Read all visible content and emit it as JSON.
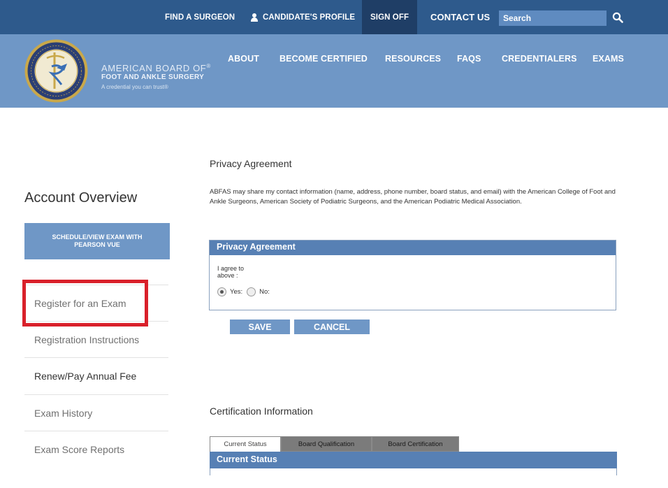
{
  "topbar": {
    "find_surgeon": "FIND A SURGEON",
    "candidate_profile": "CANDIDATE'S PROFILE",
    "sign_off": "SIGN OFF",
    "contact_us": "CONTACT US",
    "search_placeholder": "Search",
    "bar_color": "#2e5a8c"
  },
  "brand": {
    "line1": "AMERICAN BOARD OF",
    "line2": "FOOT AND ANKLE SURGERY",
    "tagline": "A credential you can trust"
  },
  "main_nav": [
    "ABOUT",
    "BECOME CERTIFIED",
    "RESOURCES",
    "FAQS",
    "CREDENTIALERS",
    "EXAMS"
  ],
  "sidebar": {
    "title": "Account Overview",
    "schedule_button": "SCHEDULE/VIEW EXAM WITH PEARSON VUE",
    "items": [
      {
        "label": "Register for an Exam"
      },
      {
        "label": "Registration Instructions"
      },
      {
        "label": "Renew/Pay Annual Fee"
      },
      {
        "label": "Exam History"
      },
      {
        "label": "Exam Score Reports"
      }
    ],
    "highlight_color": "#d9202a"
  },
  "privacy": {
    "heading": "Privacy Agreement",
    "text": "ABFAS may share my contact information (name, address, phone number, board status, and email) with the American College of Foot and Ankle Surgeons, American Society of Podiatric Surgeons, and the American Podiatric Medical Association.",
    "panel_title": "Privacy Agreement",
    "agree_line1": "I agree to",
    "agree_line2": "above :",
    "yes_label": "Yes:",
    "no_label": "No:",
    "selected": "Yes"
  },
  "buttons": {
    "save": "SAVE",
    "cancel": "CANCEL"
  },
  "certification": {
    "heading": "Certification Information",
    "tabs": [
      "Current Status",
      "Board Qualification",
      "Board Certification"
    ],
    "active_tab": "Current Status",
    "panel_title": "Current Status"
  },
  "colors": {
    "header": "#6f97c6",
    "panel_header": "#5780b4"
  }
}
